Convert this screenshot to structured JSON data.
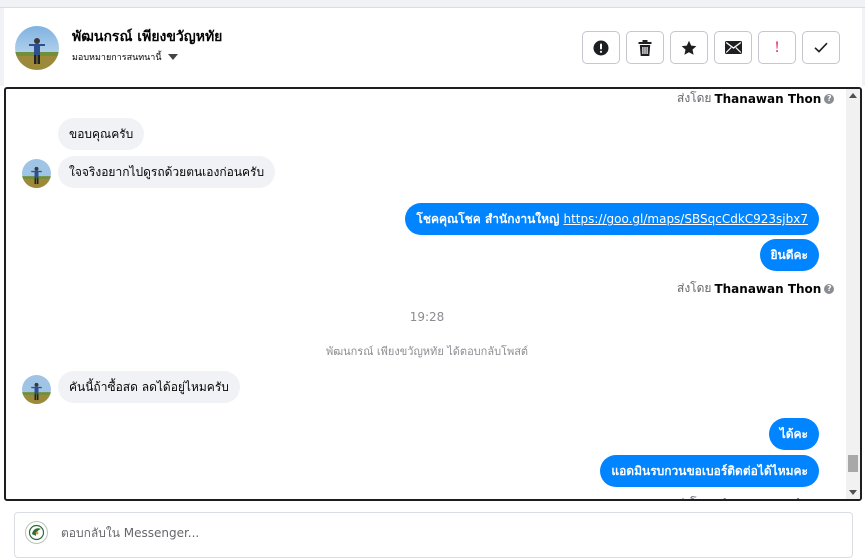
{
  "header": {
    "contact_name": "พัฒนกรณ์ เพียงขวัญหทัย",
    "assign_label": "มอบหมายการสนทนานี้"
  },
  "actions": [
    {
      "icon": "alert-circle-icon",
      "label": ""
    },
    {
      "icon": "trash-icon",
      "label": ""
    },
    {
      "icon": "star-icon",
      "label": ""
    },
    {
      "icon": "envelope-icon",
      "label": ""
    },
    {
      "icon": "exclamation-icon",
      "label": "!"
    },
    {
      "icon": "checkmark-icon",
      "label": ""
    }
  ],
  "chat": {
    "sent_by_prefix": "ส่งโดย",
    "sent_by_name": "Thanawan Thon",
    "messages": [
      {
        "text": "ขอบคุณครับ"
      },
      {
        "text": "ใจจริงอยากไปดูรถด้วยตนเองก่อนครับ"
      },
      {
        "text": "โชคคุณโชค สำนักงานใหญ่ ",
        "link": "https://goo.gl/maps/SBSqcCdkC923sjbx7"
      },
      {
        "text": "ยินดีคะ"
      },
      {
        "text": "คันนี้ถ้าซื้อสด ลดได้อยู่ไหมครับ"
      },
      {
        "text": "ได้คะ"
      },
      {
        "text": "แอดมินรบกวนขอเบอร์ติดต่อได้ไหมคะ"
      }
    ],
    "timestamp": "19:28",
    "notice": "พัฒนกรณ์ เพียงขวัญหทัย ได้ตอบกลับโพสต์"
  },
  "composer": {
    "placeholder": "ตอบกลับใน Messenger..."
  },
  "colors": {
    "outgoing_bubble": "#0084ff",
    "incoming_bubble": "#f0f2f5",
    "alert_red": "#e0245e"
  }
}
